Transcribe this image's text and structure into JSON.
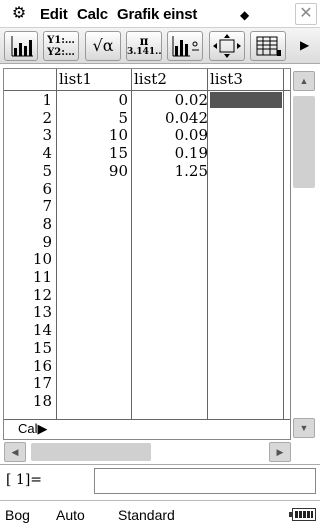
{
  "menubar": {
    "items": [
      {
        "label": "Edit"
      },
      {
        "label": "Calc"
      },
      {
        "label": "Grafik einst"
      }
    ],
    "diamond": "◆",
    "close": "✕"
  },
  "toolbar": {
    "buttons": [
      {
        "name": "graph-icon"
      },
      {
        "name": "y1-y2-list-icon",
        "line1": "Y1:…",
        "line2": "Y2:…"
      },
      {
        "name": "sqrt-alpha-icon",
        "label": "√α"
      },
      {
        "name": "pi-decimal-icon",
        "line1": "π",
        "line2": "3.141.."
      },
      {
        "name": "stat-graph-settings-icon"
      },
      {
        "name": "view-window-icon"
      },
      {
        "name": "list-editor-icon"
      }
    ],
    "more": "▶"
  },
  "table": {
    "headers": [
      "list1",
      "list2",
      "list3"
    ],
    "row_numbers": [
      "1",
      "2",
      "3",
      "4",
      "5",
      "6",
      "7",
      "8",
      "9",
      "10",
      "11",
      "12",
      "13",
      "14",
      "15",
      "16",
      "17",
      "18"
    ],
    "list1": [
      "0",
      "5",
      "10",
      "15",
      "90"
    ],
    "list2": [
      "0.02",
      "0.042",
      "0.09",
      "0.19",
      "1.25"
    ],
    "cal_label": "Cal▶"
  },
  "entry": {
    "label": "[  1]="
  },
  "status": {
    "angle": "Bog",
    "mode": "Auto",
    "format": "Standard"
  },
  "colors": {
    "cursor": "#555555",
    "toolbar_bg": "#dcdcdc"
  }
}
